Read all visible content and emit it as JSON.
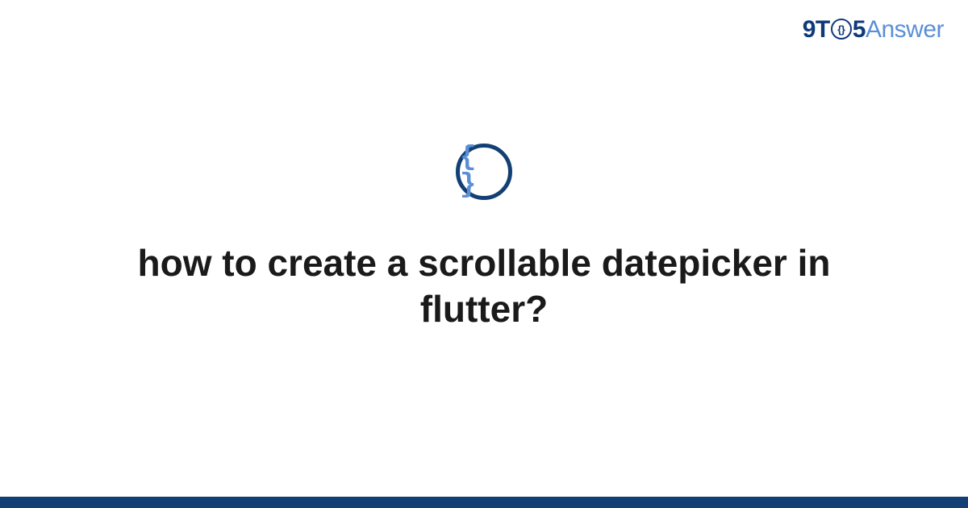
{
  "logo": {
    "part1": "9T",
    "clock_inner": "{}",
    "part2": "5",
    "part3": "Answer"
  },
  "icon": {
    "symbol": "{ }"
  },
  "title": "how to create a scrollable datepicker in flutter?"
}
